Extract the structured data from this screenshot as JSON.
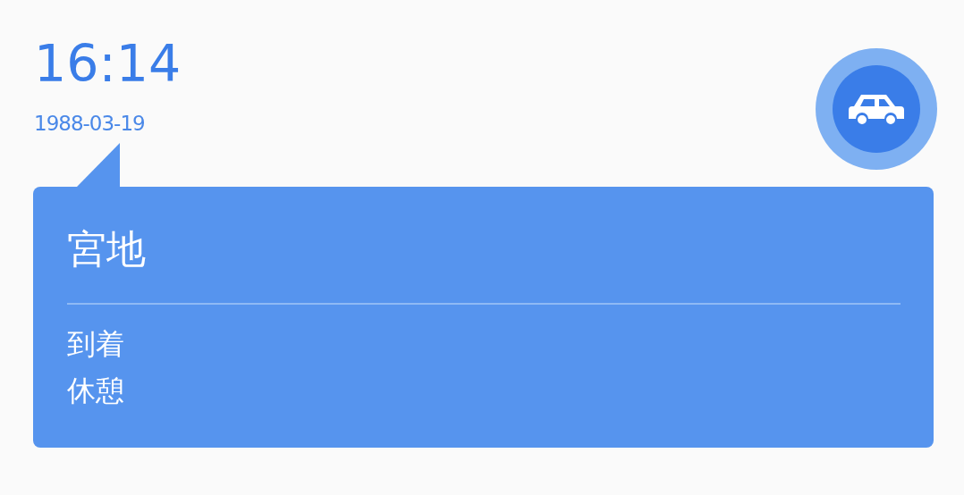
{
  "time": "16:14",
  "date": "1988-03-19",
  "card": {
    "title": "宮地",
    "lines": [
      "到着",
      "休憩"
    ]
  }
}
